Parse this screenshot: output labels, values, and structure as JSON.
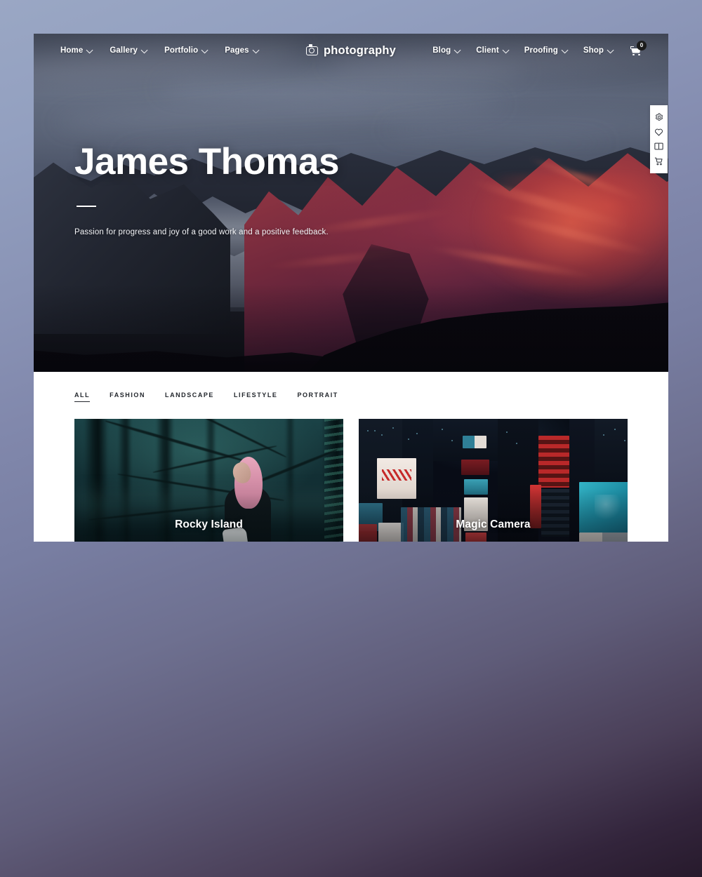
{
  "navbar": {
    "left_items": [
      {
        "label": "Home",
        "icon": "chevron-down-icon"
      },
      {
        "label": "Gallery",
        "icon": "chevron-down-icon"
      },
      {
        "label": "Portfolio",
        "icon": "chevron-down-icon"
      },
      {
        "label": "Pages",
        "icon": "chevron-down-icon"
      }
    ],
    "brand": {
      "label": "photography",
      "icon": "camera-icon"
    },
    "right_items": [
      {
        "label": "Blog",
        "icon": "chevron-down-icon"
      },
      {
        "label": "Client",
        "icon": "chevron-down-icon"
      },
      {
        "label": "Proofing",
        "icon": "chevron-down-icon"
      },
      {
        "label": "Shop",
        "icon": "chevron-down-icon"
      }
    ],
    "cart": {
      "icon": "shopping-cart-icon",
      "badge_count": "0"
    }
  },
  "hero": {
    "title": "James Thomas",
    "subtitle": "Passion for progress and joy of a good work and a positive feedback."
  },
  "toolbar": {
    "buttons": [
      {
        "icon": "gear-icon",
        "label": "Settings"
      },
      {
        "icon": "heart-icon",
        "label": "Favorites"
      },
      {
        "icon": "book-icon",
        "label": "Album"
      },
      {
        "icon": "shopping-cart-icon",
        "label": "Cart"
      }
    ]
  },
  "gallery": {
    "filters": [
      {
        "label": "ALL",
        "active": true
      },
      {
        "label": "FASHION",
        "active": false
      },
      {
        "label": "LANDSCAPE",
        "active": false
      },
      {
        "label": "LIFESTYLE",
        "active": false
      },
      {
        "label": "PORTRAIT",
        "active": false
      }
    ],
    "cards": [
      {
        "title": "Rocky Island"
      },
      {
        "title": "Magic Camera"
      }
    ]
  },
  "colors": {
    "page_gradient_top": "#9aa7c4",
    "page_gradient_bottom": "#271a2c",
    "nav_text": "#ffffff",
    "filter_text": "#22262c",
    "badge_bg": "#1b1b1b",
    "panel_bg": "#ffffff"
  }
}
